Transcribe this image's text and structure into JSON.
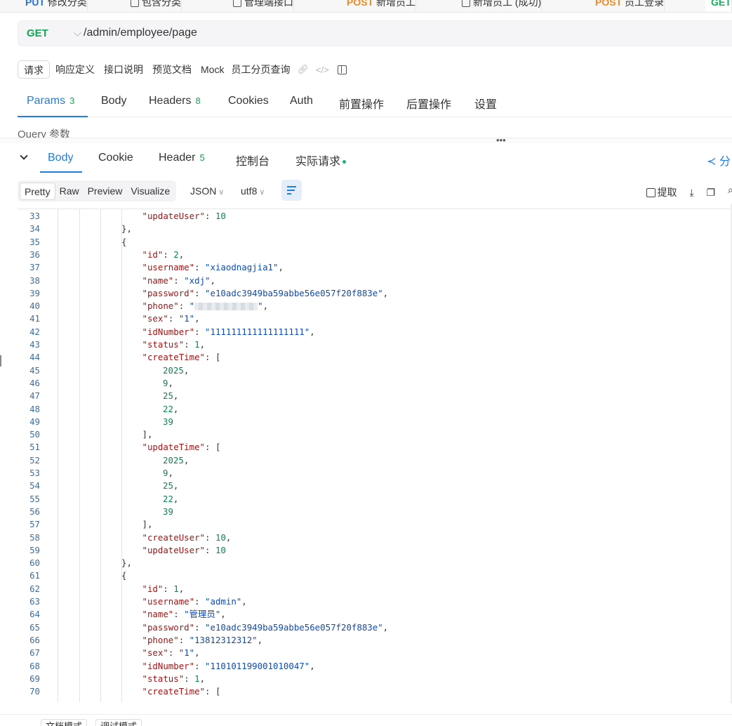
{
  "top_tabs": [
    {
      "method": "PUT",
      "label": "修改分类",
      "icon": ""
    },
    {
      "method": "",
      "label": "包含分类",
      "icon": "folder-icon"
    },
    {
      "method": "",
      "label": "管理端接口",
      "icon": "folder-icon"
    },
    {
      "method": "POST",
      "label": "新增员工",
      "icon": ""
    },
    {
      "method": "",
      "label": "新增员工 (成功)",
      "icon": "case-icon"
    },
    {
      "method": "POST",
      "label": "员工登录",
      "icon": ""
    },
    {
      "method": "GET",
      "label": "",
      "icon": ""
    }
  ],
  "url_bar": {
    "method": "GET",
    "path": "/admin/employee/page"
  },
  "doc_tabs": {
    "items": [
      "请求",
      "响应定义",
      "接口说明",
      "预览文档",
      "Mock"
    ],
    "active": "请求",
    "title": "员工分页查询"
  },
  "request_tabs": {
    "params_label": "Params",
    "params_count": "3",
    "body_label": "Body",
    "headers_label": "Headers",
    "headers_count": "8",
    "cookies_label": "Cookies",
    "auth_label": "Auth",
    "pre_label": "前置操作",
    "post_label": "后置操作",
    "settings_label": "设置",
    "active": "Params"
  },
  "query_label": "Query 参数",
  "response_tabs": {
    "body_label": "Body",
    "cookie_label": "Cookie",
    "header_label": "Header",
    "header_count": "5",
    "console_label": "控制台",
    "actual_label": "实际请求",
    "share_label": "分",
    "active": "Body"
  },
  "toolbar": {
    "formats": [
      "Pretty",
      "Raw",
      "Preview",
      "Visualize"
    ],
    "active_format": "Pretty",
    "language": "JSON",
    "encoding": "utf8",
    "extract_label": "提取"
  },
  "code_lines": [
    {
      "n": "33",
      "indent": 2,
      "key": "updateUser",
      "val": "10",
      "type": "num",
      "end": ""
    },
    {
      "n": "34",
      "indent": 1,
      "raw": "},"
    },
    {
      "n": "35",
      "indent": 1,
      "raw": "{"
    },
    {
      "n": "36",
      "indent": 2,
      "key": "id",
      "val": "2",
      "type": "num",
      "end": ","
    },
    {
      "n": "37",
      "indent": 2,
      "key": "username",
      "val": "\"xiaodnagjia1\"",
      "type": "str",
      "end": ","
    },
    {
      "n": "38",
      "indent": 2,
      "key": "name",
      "val": "\"xdj\"",
      "type": "str",
      "end": ","
    },
    {
      "n": "39",
      "indent": 2,
      "key": "password",
      "val": "\"e10adc3949ba59abbe56e057f20f883e\"",
      "type": "str",
      "end": ","
    },
    {
      "n": "40",
      "indent": 2,
      "key": "phone",
      "val": "masked",
      "type": "masked",
      "end": ","
    },
    {
      "n": "41",
      "indent": 2,
      "key": "sex",
      "val": "\"1\"",
      "type": "str",
      "end": ","
    },
    {
      "n": "42",
      "indent": 2,
      "key": "idNumber",
      "val": "\"111111111111111111\"",
      "type": "str",
      "end": ","
    },
    {
      "n": "43",
      "indent": 2,
      "key": "status",
      "val": "1",
      "type": "num",
      "end": ","
    },
    {
      "n": "44",
      "indent": 2,
      "key": "createTime",
      "val": "[",
      "type": "punc",
      "end": ""
    },
    {
      "n": "45",
      "indent": 3,
      "num": "2025",
      "end": ","
    },
    {
      "n": "46",
      "indent": 3,
      "num": "9",
      "end": ","
    },
    {
      "n": "47",
      "indent": 3,
      "num": "25",
      "end": ","
    },
    {
      "n": "48",
      "indent": 3,
      "num": "22",
      "end": ","
    },
    {
      "n": "49",
      "indent": 3,
      "num": "39",
      "end": ""
    },
    {
      "n": "50",
      "indent": 2,
      "raw": "],"
    },
    {
      "n": "51",
      "indent": 2,
      "key": "updateTime",
      "val": "[",
      "type": "punc",
      "end": ""
    },
    {
      "n": "52",
      "indent": 3,
      "num": "2025",
      "end": ","
    },
    {
      "n": "53",
      "indent": 3,
      "num": "9",
      "end": ","
    },
    {
      "n": "54",
      "indent": 3,
      "num": "25",
      "end": ","
    },
    {
      "n": "55",
      "indent": 3,
      "num": "22",
      "end": ","
    },
    {
      "n": "56",
      "indent": 3,
      "num": "39",
      "end": ""
    },
    {
      "n": "57",
      "indent": 2,
      "raw": "],"
    },
    {
      "n": "58",
      "indent": 2,
      "key": "createUser",
      "val": "10",
      "type": "num",
      "end": ","
    },
    {
      "n": "59",
      "indent": 2,
      "key": "updateUser",
      "val": "10",
      "type": "num",
      "end": ""
    },
    {
      "n": "60",
      "indent": 1,
      "raw": "},"
    },
    {
      "n": "61",
      "indent": 1,
      "raw": "{"
    },
    {
      "n": "62",
      "indent": 2,
      "key": "id",
      "val": "1",
      "type": "num",
      "end": ","
    },
    {
      "n": "63",
      "indent": 2,
      "key": "username",
      "val": "\"admin\"",
      "type": "str",
      "end": ","
    },
    {
      "n": "64",
      "indent": 2,
      "key": "name",
      "val": "\"管理员\"",
      "type": "str",
      "end": ","
    },
    {
      "n": "65",
      "indent": 2,
      "key": "password",
      "val": "\"e10adc3949ba59abbe56e057f20f883e\"",
      "type": "str",
      "end": ","
    },
    {
      "n": "66",
      "indent": 2,
      "key": "phone",
      "val": "\"13812312312\"",
      "type": "str",
      "end": ","
    },
    {
      "n": "67",
      "indent": 2,
      "key": "sex",
      "val": "\"1\"",
      "type": "str",
      "end": ","
    },
    {
      "n": "68",
      "indent": 2,
      "key": "idNumber",
      "val": "\"110101199001010047\"",
      "type": "str",
      "end": ","
    },
    {
      "n": "69",
      "indent": 2,
      "key": "status",
      "val": "1",
      "type": "num",
      "end": ","
    },
    {
      "n": "70",
      "indent": 2,
      "key": "createTime",
      "val": "[",
      "type": "punc",
      "end": ""
    }
  ],
  "bottom_tabs": [
    "文档模式",
    "调试模式"
  ],
  "colors": {
    "accent": "#1f7ee6",
    "get": "#12a455",
    "post": "#f08a24",
    "put": "#2a72d5",
    "count": "#1f9d55"
  }
}
